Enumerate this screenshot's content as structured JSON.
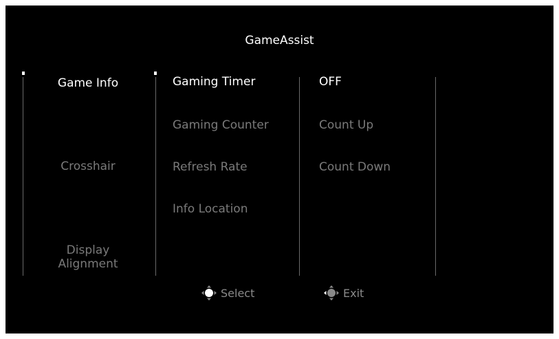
{
  "title": "GameAssist",
  "menu": {
    "level1": [
      {
        "label": "Game Info",
        "state": "active"
      },
      {
        "label": "Crosshair",
        "state": "inactive"
      },
      {
        "label": "Display\nAlignment",
        "state": "inactive"
      }
    ],
    "level2": [
      {
        "label": "Gaming Timer",
        "state": "active"
      },
      {
        "label": "Gaming Counter",
        "state": "inactive"
      },
      {
        "label": "Refresh Rate",
        "state": "inactive"
      },
      {
        "label": "Info Location",
        "state": "inactive"
      }
    ],
    "level3": [
      {
        "label": "OFF",
        "state": "active"
      },
      {
        "label": "Count Up",
        "state": "inactive"
      },
      {
        "label": "Count Down",
        "state": "inactive"
      }
    ]
  },
  "footer": {
    "select_label": "Select",
    "exit_label": "Exit"
  },
  "colors": {
    "background": "#000000",
    "active_text": "#ffffff",
    "inactive_text": "#7a7a7a",
    "divider": "#6a6a6a"
  }
}
